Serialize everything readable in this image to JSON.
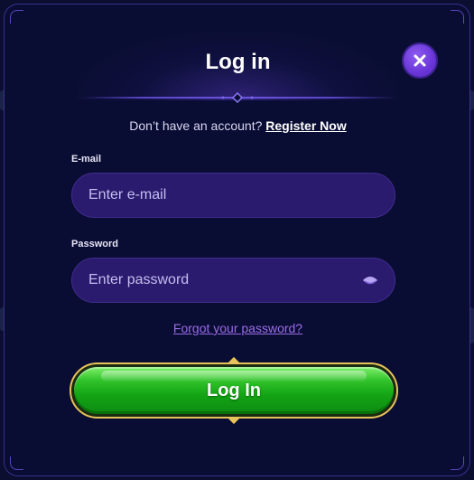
{
  "modal": {
    "title": "Log in",
    "close_label": "close"
  },
  "register": {
    "prompt": "Don’t have an account?",
    "link": "Register Now"
  },
  "email": {
    "label": "E-mail",
    "placeholder": "Enter e-mail",
    "value": ""
  },
  "password": {
    "label": "Password",
    "placeholder": "Enter password",
    "value": ""
  },
  "forgot": {
    "link": "Forgot your password?"
  },
  "login_button": {
    "label": "Log In"
  },
  "colors": {
    "modal_bg": "#0a0d33",
    "input_bg": "#2a1b6e",
    "accent_purple": "#6a35d8",
    "link_purple": "#9a6ce8",
    "button_green": "#14a414",
    "button_border_gold": "#e8c25a"
  },
  "icons": {
    "close": "close-icon",
    "password_toggle": "eye-icon",
    "divider_ornament": "diamond-ornament-icon"
  }
}
